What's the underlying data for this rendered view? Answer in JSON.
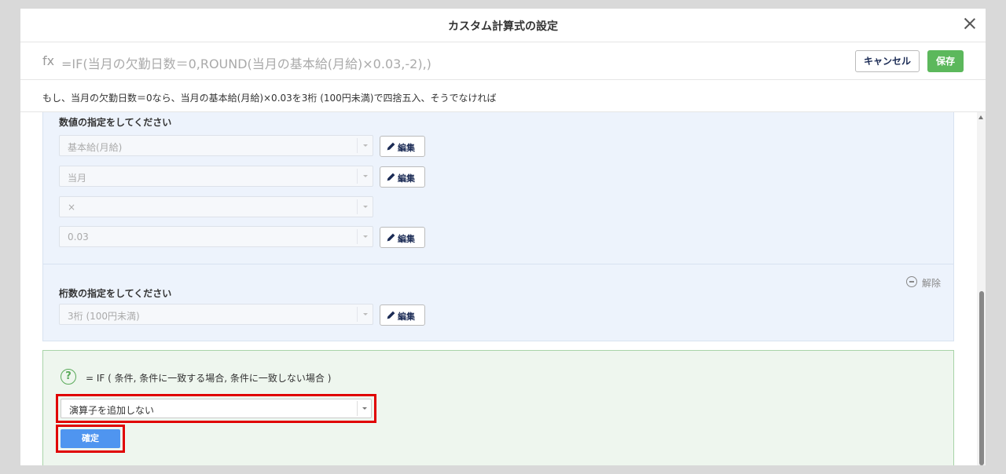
{
  "modal": {
    "title": "カスタム計算式の設定"
  },
  "formula_bar": {
    "fx_label": "fx",
    "formula": "=IF(当月の欠勤日数＝0,ROUND(当月の基本給(月給)×0.03,-2),)",
    "cancel_label": "キャンセル",
    "save_label": "保存"
  },
  "description": "もし、当月の欠勤日数＝0なら、当月の基本給(月給)×0.03を3桁 (100円未満)で四捨五入、そうでなければ",
  "numeric_section": {
    "label": "数値の指定をしてください",
    "fields": [
      {
        "value": "基本給(月給)",
        "edit_label": "編集"
      },
      {
        "value": "当月",
        "edit_label": "編集"
      },
      {
        "value": "×"
      },
      {
        "value": "0.03",
        "edit_label": "編集"
      }
    ]
  },
  "digits_section": {
    "label": "桁数の指定をしてください",
    "remove_label": "解除",
    "field": {
      "value": "3桁 (100円未満)",
      "edit_label": "編集"
    }
  },
  "if_section": {
    "help_icon": "?",
    "syntax": "= IF ( 条件, 条件に一致する場合, 条件に一致しない場合 )",
    "operator_select": "演算子を追加しない",
    "confirm_label": "確定"
  },
  "colors": {
    "save_green": "#5cb85c",
    "confirm_blue": "#4f95f0",
    "highlight_red": "#e00000",
    "section_blue_bg": "#edf3fc",
    "section_green_bg": "#eef6ee"
  }
}
